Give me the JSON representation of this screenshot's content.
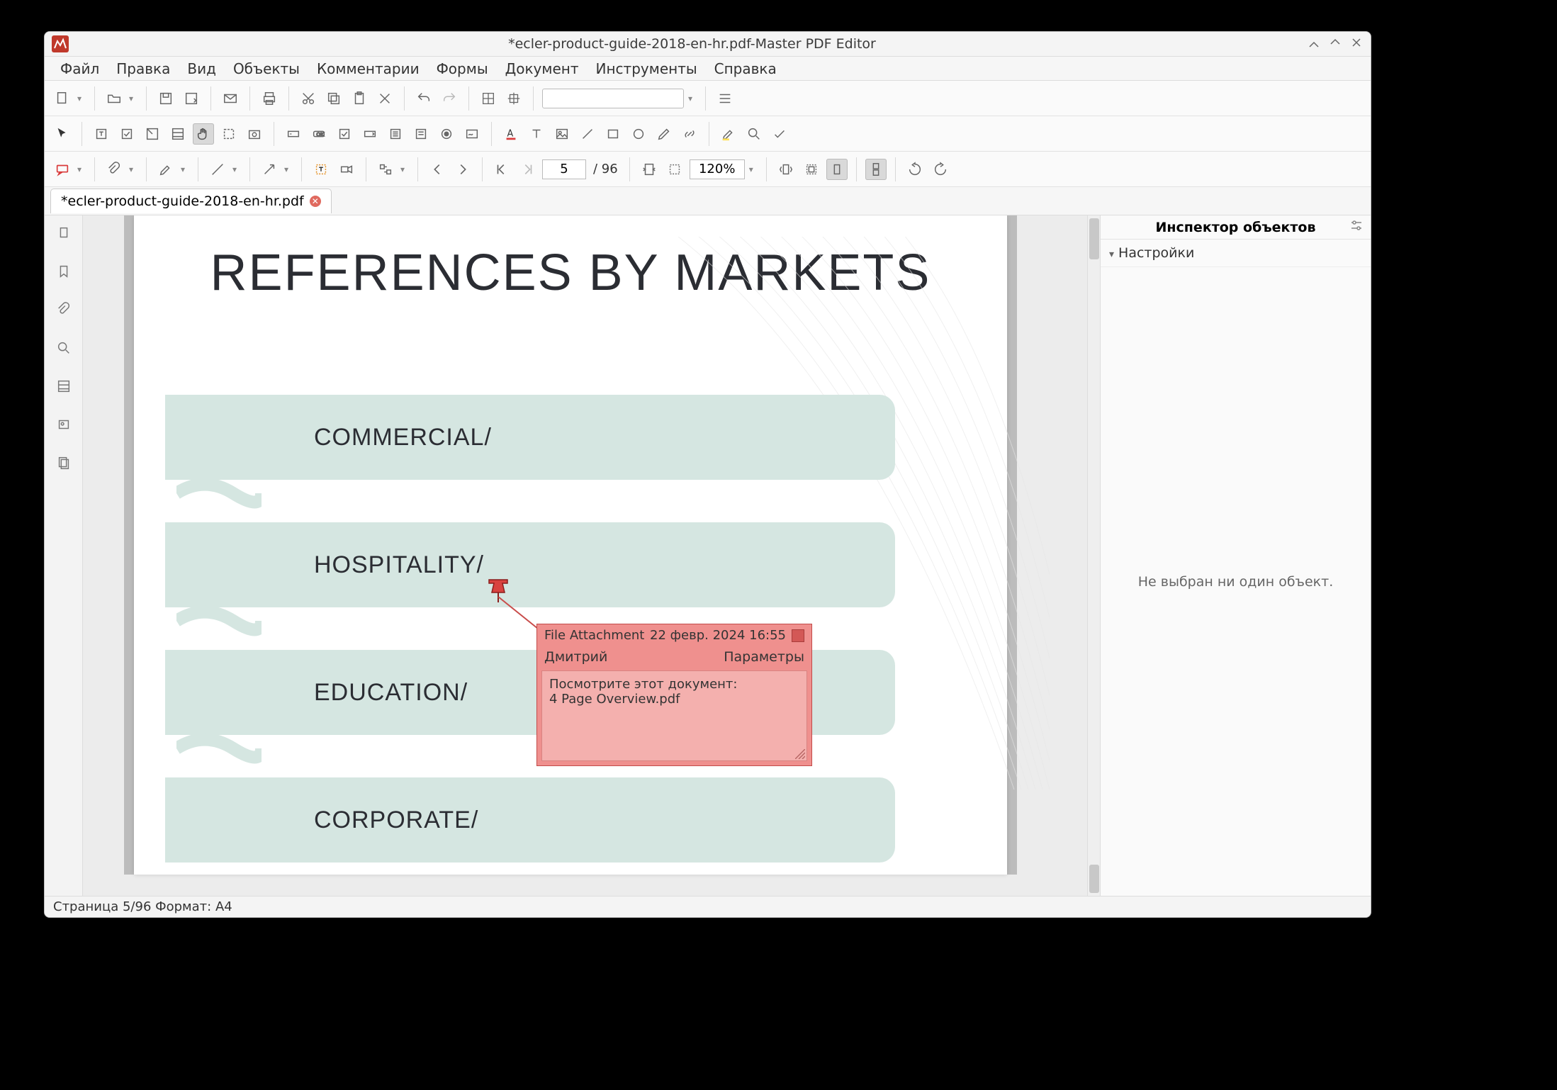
{
  "title": "*ecler-product-guide-2018-en-hr.pdf-Master PDF Editor",
  "menu": {
    "file": "Файл",
    "edit": "Правка",
    "view": "Вид",
    "objects": "Объекты",
    "comments": "Комментарии",
    "forms": "Формы",
    "document": "Документ",
    "tools": "Инструменты",
    "help": "Справка"
  },
  "tab": {
    "label": "*ecler-product-guide-2018-en-hr.pdf"
  },
  "page": {
    "current": "5",
    "total": "/ 96",
    "zoom": "120%"
  },
  "doc": {
    "heading": "REFERENCES BY MARKETS",
    "bands": [
      "COMMERCIAL/",
      "HOSPITALITY/",
      "EDUCATION/",
      "CORPORATE/"
    ]
  },
  "note": {
    "title": "File Attachment",
    "date": "22 февр. 2024 16:55",
    "author": "Дмитрий",
    "options": "Параметры",
    "line1": "Посмотрите этот документ:",
    "line2": "4 Page Overview.pdf"
  },
  "inspector": {
    "title": "Инспектор объектов",
    "section": "Настройки",
    "empty": "Не выбран ни один объект."
  },
  "status": "Страница 5/96 Формат: A4"
}
